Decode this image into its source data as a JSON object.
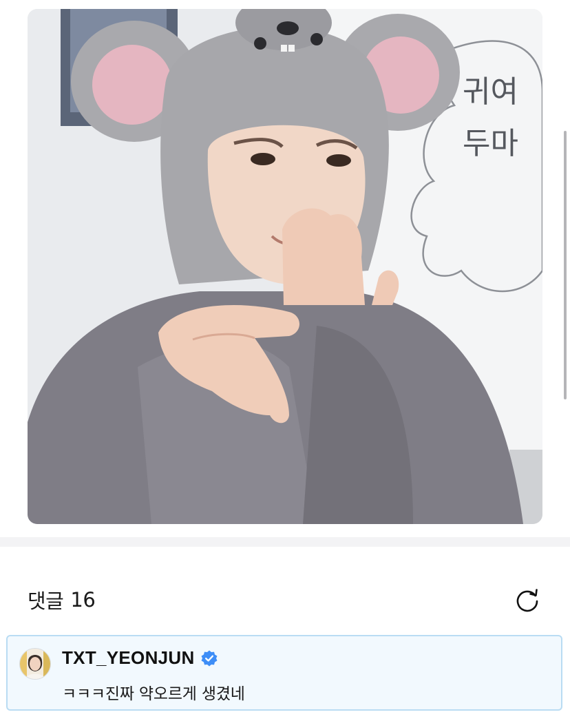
{
  "post": {
    "photo_alt": "photo",
    "whiteboard_text": [
      "귀여",
      "두마"
    ]
  },
  "comments": {
    "label": "댓글",
    "count": "16",
    "refresh_icon": "refresh-icon",
    "items": [
      {
        "author": "TXT_YEONJUN",
        "verified": true,
        "text": "ㅋㅋㅋ진짜 약오르게 생겼네",
        "highlighted": true
      }
    ]
  },
  "colors": {
    "highlight_border": "#b9dcf3",
    "highlight_bg": "#f2f9fe",
    "verified_blue": "#3e8ef7",
    "band_gray": "#f3f3f5"
  }
}
